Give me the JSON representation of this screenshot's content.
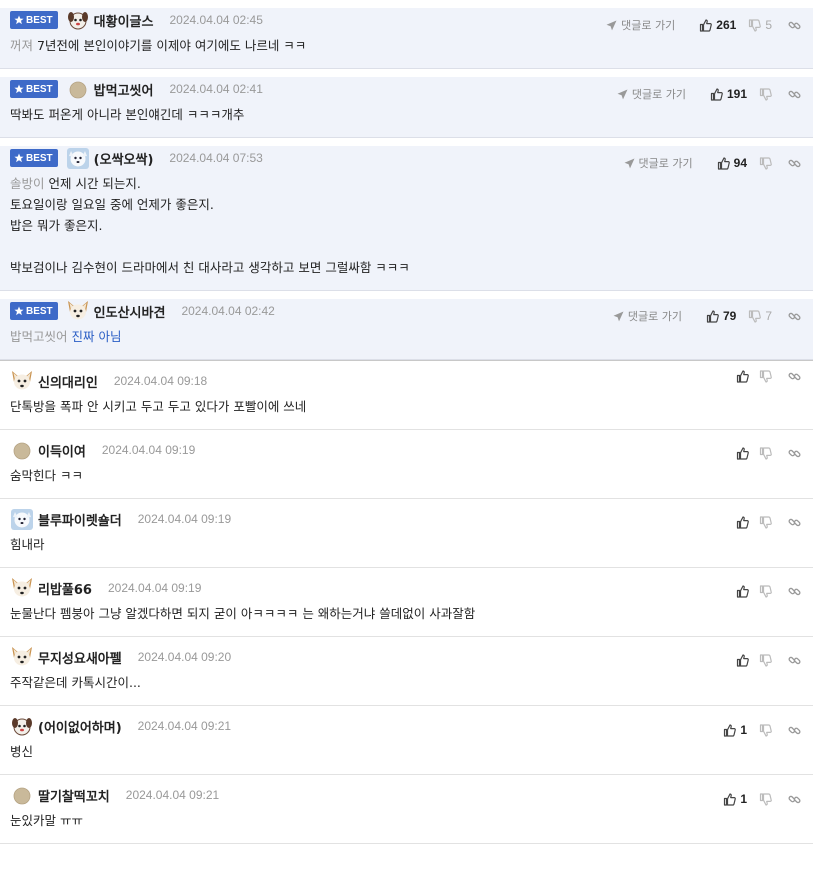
{
  "best_label": "BEST",
  "goto_label": "댓글로 가기",
  "comments": [
    {
      "best": true,
      "avatar": "puppy-avatar",
      "nick": "대황이글스",
      "date": "2024.04.04 02:45",
      "up": "261",
      "down": "5",
      "lines": [
        [
          {
            "t": "꺼져 ",
            "c": "gray"
          },
          {
            "t": "7년전에 본인이야기를 이제야 여기에도 나르네 ㅋㅋ",
            "c": ""
          }
        ]
      ]
    },
    {
      "best": true,
      "avatar": "beige-circle-avatar",
      "nick": "밥먹고씻어",
      "date": "2024.04.04 02:41",
      "up": "191",
      "down": "",
      "lines": [
        [
          {
            "t": "딱봐도 퍼온게 아니라 본인얘긴데 ㅋㅋㅋ개추",
            "c": ""
          }
        ]
      ]
    },
    {
      "best": true,
      "avatar": "snow-dog-avatar",
      "nick": "(오싹오싹)",
      "date": "2024.04.04 07:53",
      "up": "94",
      "down": "",
      "lines": [
        [
          {
            "t": "솔방이 ",
            "c": "gray"
          },
          {
            "t": "언제 시간 되는지.",
            "c": ""
          }
        ],
        [
          {
            "t": "토요일이랑 일요일 중에 언제가 좋은지.",
            "c": ""
          }
        ],
        [
          {
            "t": "밥은 뭐가 좋은지.",
            "c": ""
          }
        ],
        [
          {
            "t": "",
            "c": ""
          }
        ],
        [
          {
            "t": "박보검이나 김수현이 드라마에서 친 대사라고 생각하고 보면 그럴싸함 ㅋㅋㅋ",
            "c": ""
          }
        ]
      ]
    },
    {
      "best": true,
      "avatar": "fox-dog-avatar",
      "nick": "인도산시바견",
      "date": "2024.04.04 02:42",
      "up": "79",
      "down": "7",
      "lines": [
        [
          {
            "t": "밥먹고씻어 ",
            "c": "gray"
          },
          {
            "t": "진짜 아님",
            "c": "blue"
          }
        ]
      ]
    },
    {
      "best": false,
      "avatar": "fox-dog-avatar",
      "nick": "신의대리인",
      "date": "2024.04.04 09:18",
      "up": "",
      "down": "",
      "lines": [
        [
          {
            "t": "단톡방을 폭파 안 시키고 두고 두고 있다가 포빨이에 쓰네",
            "c": ""
          }
        ]
      ]
    },
    {
      "best": false,
      "avatar": "beige-circle-avatar",
      "nick": "이득이여",
      "date": "2024.04.04 09:19",
      "up": "",
      "down": "",
      "lines": [
        [
          {
            "t": "숨막힌다 ㅋㅋ",
            "c": ""
          }
        ]
      ]
    },
    {
      "best": false,
      "avatar": "snow-dog-avatar",
      "nick": "블루파이렛숄더",
      "date": "2024.04.04 09:19",
      "up": "",
      "down": "",
      "lines": [
        [
          {
            "t": "힘내라",
            "c": ""
          }
        ]
      ]
    },
    {
      "best": false,
      "avatar": "fox-dog-avatar",
      "nick": "리밥풀66",
      "date": "2024.04.04 09:19",
      "up": "",
      "down": "",
      "lines": [
        [
          {
            "t": "눈물난다 펨붕아 그냥 알겠다하면 되지 굳이 아ㅋㅋㅋㅋ 는 왜하는거냐 쓸데없이 사과잘함",
            "c": ""
          }
        ]
      ]
    },
    {
      "best": false,
      "avatar": "fox-dog-avatar",
      "nick": "무지성요새아펠",
      "date": "2024.04.04 09:20",
      "up": "",
      "down": "",
      "lines": [
        [
          {
            "t": "주작같은데 카톡시간이...",
            "c": ""
          }
        ]
      ]
    },
    {
      "best": false,
      "avatar": "puppy-avatar",
      "nick": "(어이없어하며)",
      "date": "2024.04.04 09:21",
      "up": "1",
      "down": "",
      "lines": [
        [
          {
            "t": "병신",
            "c": ""
          }
        ]
      ]
    },
    {
      "best": false,
      "avatar": "beige-circle-avatar",
      "nick": "딸기찰떡꼬치",
      "date": "2024.04.04 09:21",
      "up": "1",
      "down": "",
      "lines": [
        [
          {
            "t": "눈있카말 ㅠㅠ",
            "c": ""
          }
        ]
      ]
    }
  ]
}
